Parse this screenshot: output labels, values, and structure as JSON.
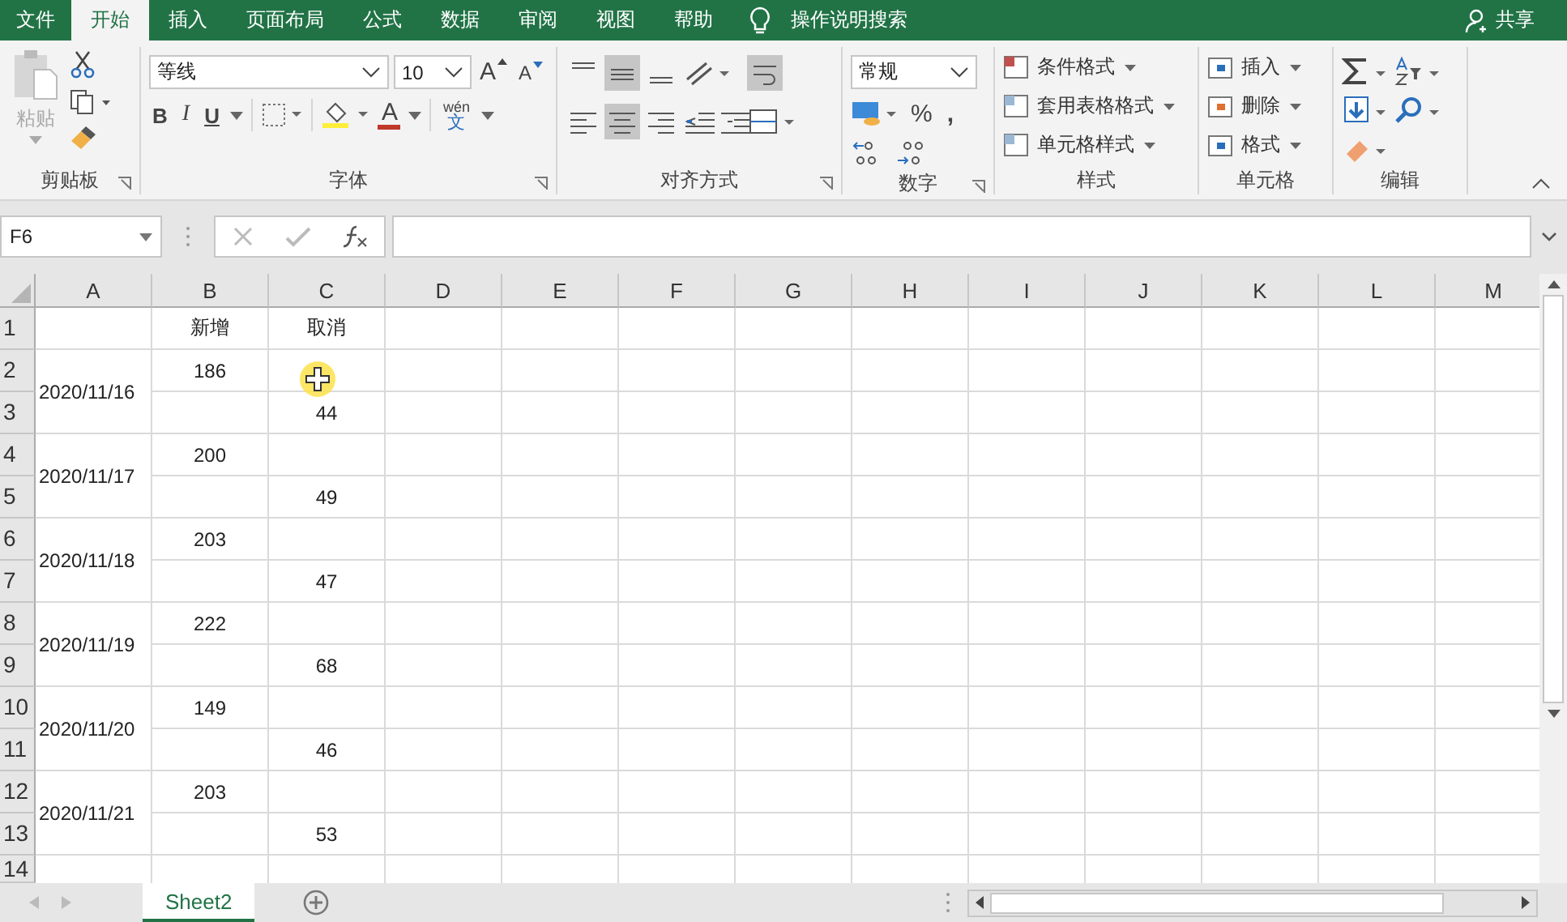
{
  "menu_tabs": [
    {
      "label": "文件",
      "selected": false
    },
    {
      "label": "开始",
      "selected": true
    },
    {
      "label": "插入",
      "selected": false
    },
    {
      "label": "页面布局",
      "selected": false
    },
    {
      "label": "公式",
      "selected": false
    },
    {
      "label": "数据",
      "selected": false
    },
    {
      "label": "审阅",
      "selected": false
    },
    {
      "label": "视图",
      "selected": false
    },
    {
      "label": "帮助",
      "selected": false
    }
  ],
  "tell_me": "操作说明搜索",
  "share": "共享",
  "clipboard": {
    "paste": "粘贴",
    "label": "剪贴板"
  },
  "font": {
    "name": "等线",
    "size": "10",
    "grow": "A",
    "shrink": "A",
    "bold": "B",
    "italic": "I",
    "underline": "U",
    "font_color": "A",
    "phonetic_top": "wén",
    "phonetic_bottom": "文",
    "label": "字体"
  },
  "alignment": {
    "label": "对齐方式"
  },
  "number": {
    "format": "常规",
    "percent": "%",
    "comma": ",",
    "label": "数字"
  },
  "styles": {
    "items": [
      "条件格式",
      "套用表格格式",
      "单元格样式"
    ],
    "label": "样式"
  },
  "cells": {
    "items": [
      "插入",
      "删除",
      "格式"
    ],
    "label": "单元格"
  },
  "editing": {
    "label": "编辑"
  },
  "name_box": "F6",
  "columns": [
    "A",
    "B",
    "C",
    "D",
    "E",
    "F",
    "G",
    "H",
    "I",
    "J",
    "K",
    "L",
    "M"
  ],
  "row_numbers": [
    "1",
    "2",
    "3",
    "4",
    "5",
    "6",
    "7",
    "8",
    "9",
    "10",
    "11",
    "12",
    "13",
    "14"
  ],
  "header": {
    "col_b": "新增",
    "col_c": "取消"
  },
  "records": [
    {
      "date": "2020/11/16",
      "new": "186",
      "cancel": "44"
    },
    {
      "date": "2020/11/17",
      "new": "200",
      "cancel": "49"
    },
    {
      "date": "2020/11/18",
      "new": "203",
      "cancel": "47"
    },
    {
      "date": "2020/11/19",
      "new": "222",
      "cancel": "68"
    },
    {
      "date": "2020/11/20",
      "new": "149",
      "cancel": "46"
    },
    {
      "date": "2020/11/21",
      "new": "203",
      "cancel": "53"
    }
  ],
  "sheet_tabs": [
    {
      "label": "Sheet2",
      "selected": true
    }
  ]
}
